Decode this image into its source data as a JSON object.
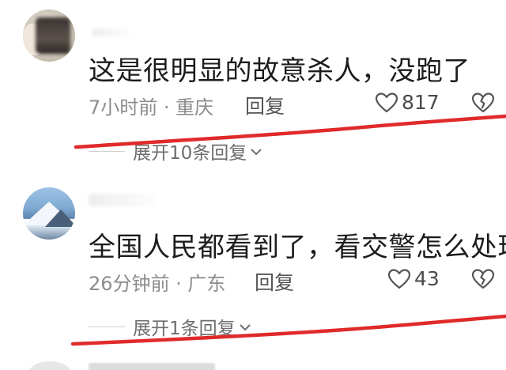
{
  "comments": [
    {
      "text": "这是很明显的故意杀人，没跑了",
      "meta": "7小时前 · 重庆",
      "reply_label": "回复",
      "likes": "817",
      "expand_label": "展开10条回复"
    },
    {
      "text": "全国人民都看到了，看交警怎么处理",
      "meta": "26分钟前 · 广东",
      "reply_label": "回复",
      "likes": "43",
      "expand_label": "展开1条回复"
    }
  ],
  "colors": {
    "annotation_red": "#e02a2a",
    "text": "#1c1c1c",
    "meta": "#8c8c8c"
  },
  "icons": {
    "like": "heart-outline-icon",
    "dislike": "broken-heart-icon",
    "expand": "chevron-down-icon"
  }
}
